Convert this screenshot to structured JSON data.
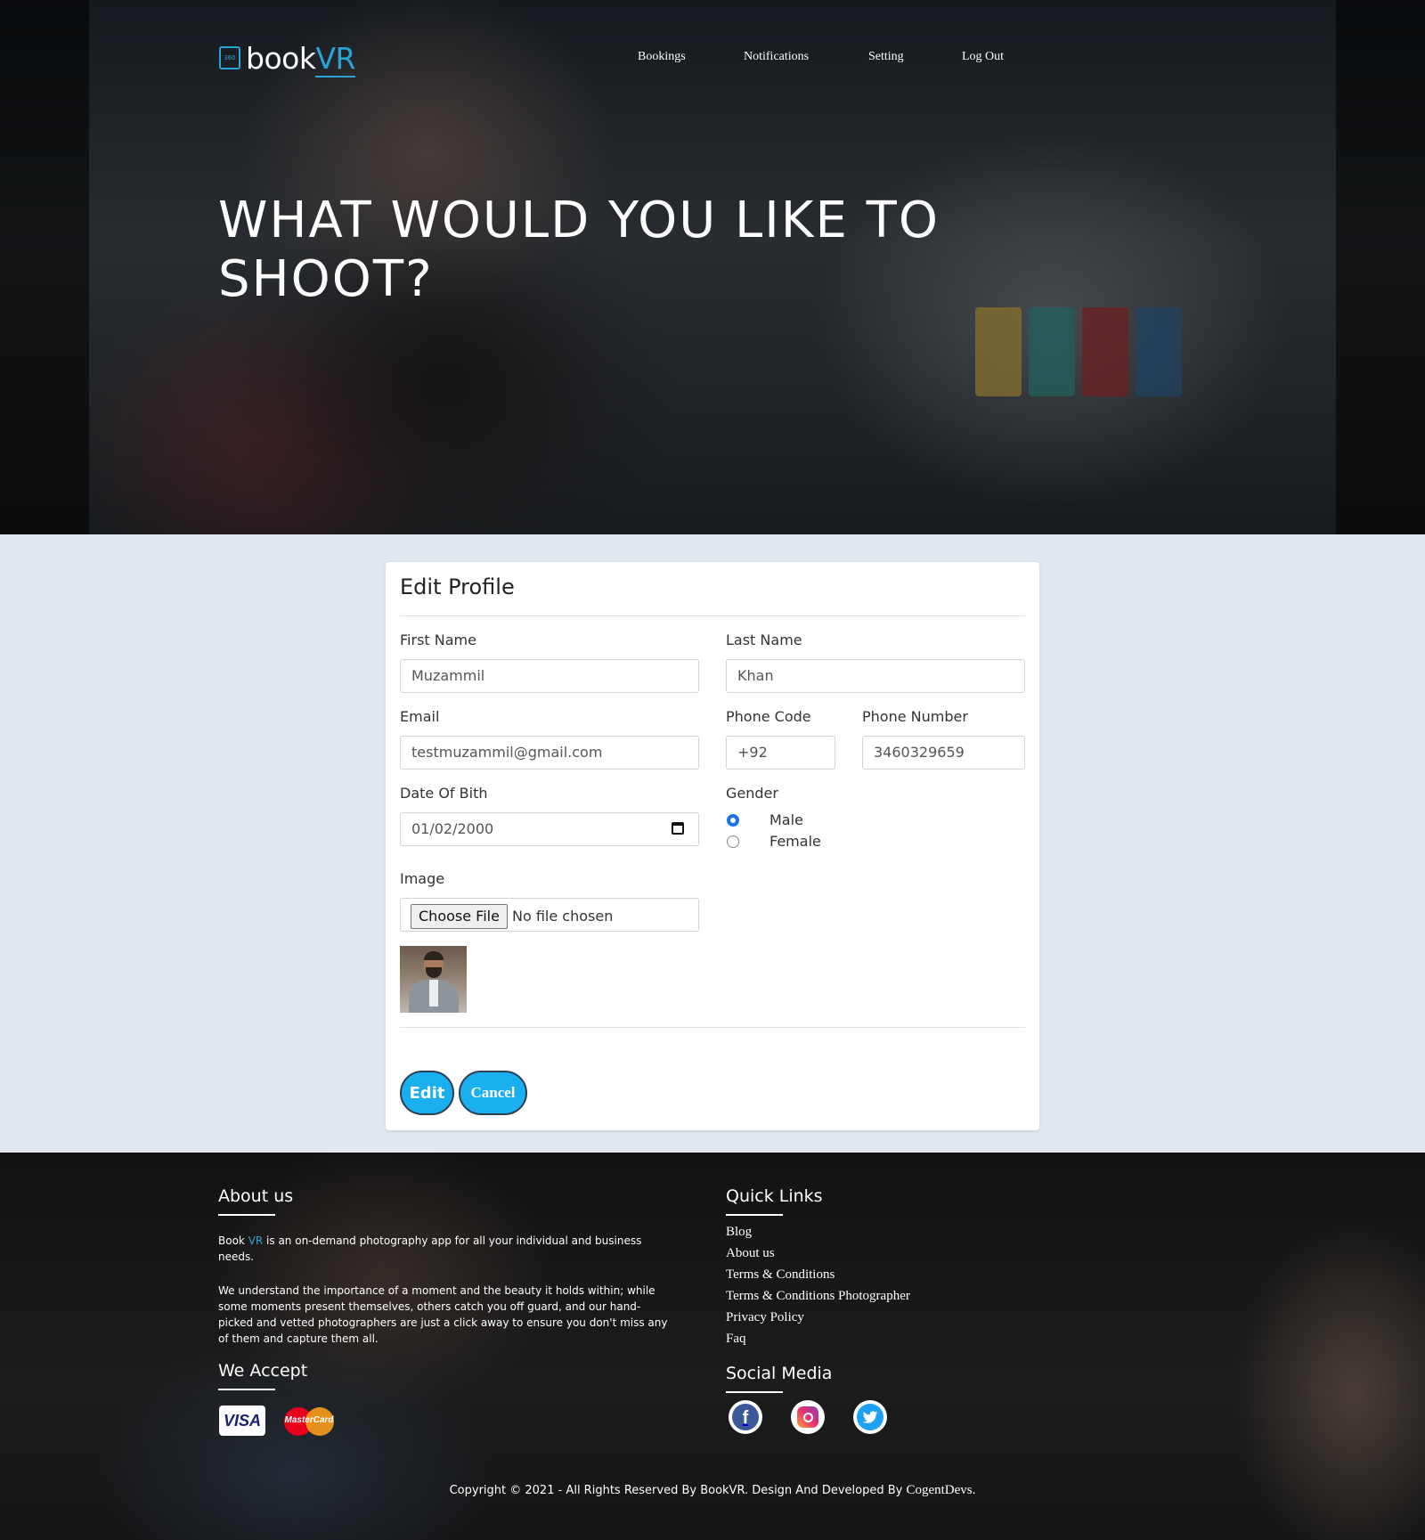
{
  "header": {
    "logo_text": "book",
    "logo_accent": "VR",
    "logo_badge": "360",
    "nav": [
      "Bookings",
      "Notifications",
      "Setting",
      "Log Out"
    ],
    "hero_title_line1": "WHAT WOULD YOU LIKE TO",
    "hero_title_line2": "SHOOT?"
  },
  "form": {
    "title": "Edit Profile",
    "first_name": {
      "label": "First Name",
      "value": "Muzammil"
    },
    "last_name": {
      "label": "Last Name",
      "value": "Khan"
    },
    "email": {
      "label": "Email",
      "value": "testmuzammil@gmail.com"
    },
    "phone_code": {
      "label": "Phone Code",
      "value": "+92"
    },
    "phone_number": {
      "label": "Phone Number",
      "value": "3460329659"
    },
    "dob": {
      "label": "Date Of Bith",
      "value": "01/02/2000"
    },
    "gender": {
      "label": "Gender",
      "options": [
        "Male",
        "Female"
      ],
      "selected": "Male"
    },
    "image": {
      "label": "Image",
      "button": "Choose File",
      "status": "No file chosen"
    },
    "edit_label": "Edit",
    "cancel_label": "Cancel"
  },
  "footer": {
    "about_title": "About us",
    "about_p1_prefix": "Book ",
    "about_p1_accent": "VR",
    "about_p1_line1_rest": " is an on-demand photography app for all your individual and business",
    "about_p1_line2": "needs.",
    "about_p2_line1": "We understand the importance of a moment and the beauty it holds within; while",
    "about_p2_line2": "some moments present themselves, others catch you off guard, and our hand-",
    "about_p2_line3": "picked and vetted photographers are just a click away to ensure you don't miss any",
    "about_p2_line4": "of them and capture them all.",
    "accept_title": "We Accept",
    "visa_label": "VISA",
    "mastercard_label": "MasterCard",
    "quick_links_title": "Quick Links",
    "quick_links": [
      "Blog",
      "About us",
      "Terms & Conditions",
      "Terms & Conditions Photographer",
      "Privacy Policy",
      "Faq"
    ],
    "social_title": "Social Media",
    "facebook_glyph": "f",
    "copyright_main": "Copyright © 2021 - All Rights Reserved By BookVR. Design And Developed By ",
    "copyright_dev": "CogentDevs."
  },
  "colors": {
    "accent": "#2aa3d8",
    "button": "#1ab0ef",
    "page_bg": "#e1e8f0",
    "radio_checked": "#1a73e8"
  },
  "icons": [
    "logo-360-icon",
    "calendar-icon",
    "facebook-icon",
    "instagram-icon",
    "twitter-icon",
    "visa-icon",
    "mastercard-icon"
  ]
}
